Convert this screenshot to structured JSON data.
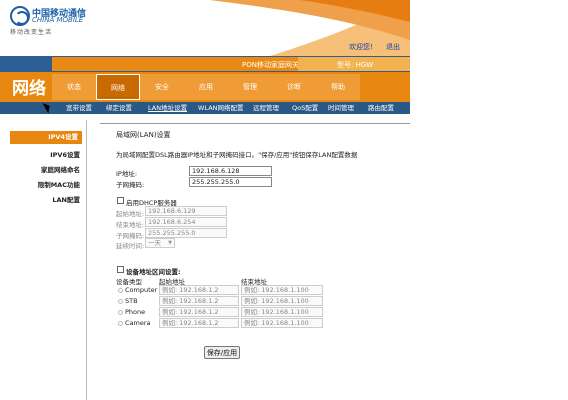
{
  "header": {
    "brand_cn": "中国移动通信",
    "brand_en": "CHINA MOBILE",
    "slogan": "移动改变生活",
    "welcome": "欢迎您!",
    "logout": "退出"
  },
  "band": {
    "device": "PON移动家庭网关",
    "model": "型号: HGW"
  },
  "nav": {
    "section_title": "网络",
    "tabs": [
      "状态",
      "网络",
      "安全",
      "应用",
      "管理",
      "诊断",
      "帮助"
    ],
    "active_tab": "网络"
  },
  "subnav": {
    "items": [
      "宽带设置",
      "绑定设置",
      "LAN地址设置",
      "WLAN网络配置",
      "远程管理",
      "QoS配置",
      "时间管理",
      "路由配置"
    ],
    "active": "LAN地址设置"
  },
  "sidebar": {
    "items": [
      "IPV4设置",
      "IPV6设置",
      "家庭网络命名",
      "限制MAC功能",
      "LAN配置"
    ],
    "active": "IPV4设置"
  },
  "main": {
    "title": "局域网(LAN)设置",
    "description": "为局域网配置DSL路由器IP地址和子网掩码接口。\"保存/应用\"按钮保存LAN配置数据",
    "ip_label": "IP地址:",
    "ip_value": "192.168.6.128",
    "mask_label": "子网掩码:",
    "mask_value": "255.255.255.0",
    "dhcp": {
      "checkbox_label": "启用DHCP服务器",
      "start_label": "起始地址:",
      "start_value": "192.168.6.129",
      "end_label": "结束地址:",
      "end_value": "192.168.6.254",
      "mask_label": "子网掩码:",
      "mask_value": "255.255.255.0",
      "lease_label": "延续时间:",
      "lease_value": "一天"
    },
    "range": {
      "checkbox_label": "设备地址区间设置:",
      "col_type": "设备类型",
      "col_start": "起始地址",
      "col_end": "结束地址",
      "rows": [
        {
          "type": "Computer",
          "start": "例如: 192.168.1.2",
          "end": "例如: 192.168.1.100"
        },
        {
          "type": "STB",
          "start": "例如: 192.168.1.2",
          "end": "例如: 192.168.1.100"
        },
        {
          "type": "Phone",
          "start": "例如: 192.168.1.2",
          "end": "例如: 192.168.1.100"
        },
        {
          "type": "Camera",
          "start": "例如: 192.168.1.2",
          "end": "例如: 192.168.1.100"
        }
      ]
    },
    "save_button": "保存/应用"
  },
  "colors": {
    "orange": "#e8870f",
    "blue_band": "#2d5e95",
    "brand_blue": "#1c5fa8"
  }
}
